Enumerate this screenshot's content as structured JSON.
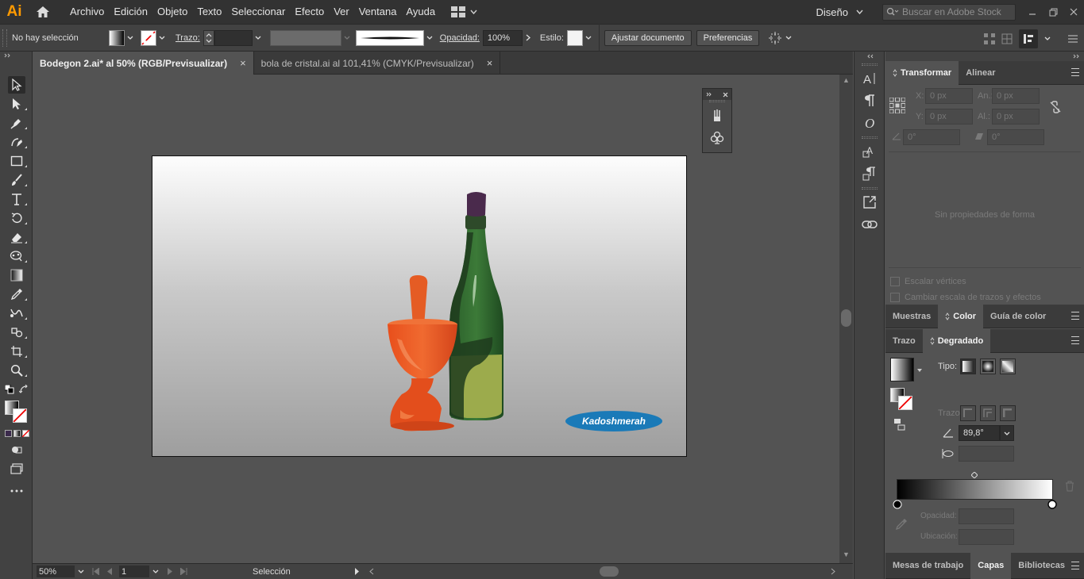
{
  "app": {
    "logo": "Ai"
  },
  "menu": [
    "Archivo",
    "Edición",
    "Objeto",
    "Texto",
    "Seleccionar",
    "Efecto",
    "Ver",
    "Ventana",
    "Ayuda"
  ],
  "workspace": "Diseño",
  "stock_search": {
    "placeholder": "Buscar en Adobe Stock"
  },
  "controlbar": {
    "selection_status": "No hay selección",
    "stroke_label": "Trazo:",
    "opacity_label": "Opacidad:",
    "opacity_value": "100%",
    "style_label": "Estilo:",
    "fit_document_button": "Ajustar documento",
    "preferences_button": "Preferencias"
  },
  "tabs": [
    {
      "label": "Bodegon 2.ai* al 50% (RGB/Previsualizar)",
      "close": "×"
    },
    {
      "label": "bola de cristal.ai al 101,41% (CMYK/Previsualizar)",
      "close": "×"
    }
  ],
  "artwork": {
    "signature_text": "Kadoshmerah"
  },
  "statusbar": {
    "zoom": "50%",
    "artboard_number": "1",
    "tool_status": "Selección"
  },
  "transform_panel": {
    "tabs": [
      "Transformar",
      "Alinear"
    ],
    "x_label": "X:",
    "x_value": "0 px",
    "width_label": "An.:",
    "width_value": "0 px",
    "y_label": "Y:",
    "y_value": "0 px",
    "height_label": "Al.:",
    "height_value": "0 px",
    "angle_value": "0°",
    "shear_value": "0°",
    "empty_message": "Sin propiedades de forma",
    "scale_corners": "Escalar vértices",
    "scale_strokes": "Cambiar escala de trazos y efectos"
  },
  "color_panel": {
    "tabs": [
      "Muestras",
      "Color",
      "Guía de color"
    ]
  },
  "gradient_panel": {
    "tabs": [
      "Trazo",
      "Degradado"
    ],
    "type_label": "Tipo:",
    "stroke_label": "Trazo:",
    "angle_value": "89,8°",
    "opacity_label": "Opacidad:",
    "location_label": "Ubicación:"
  },
  "bottom_panel": {
    "tabs": [
      "Mesas de trabajo",
      "Capas",
      "Bibliotecas"
    ]
  },
  "colors": {
    "accent_orange": "#ff9a00",
    "signature_blue": "#1a7ab8",
    "mortar_orange": "#e2501e",
    "bottle_green": "#2f6a2e",
    "label_green": "#9aaa4a",
    "cork_purple": "#4a2a4c"
  }
}
